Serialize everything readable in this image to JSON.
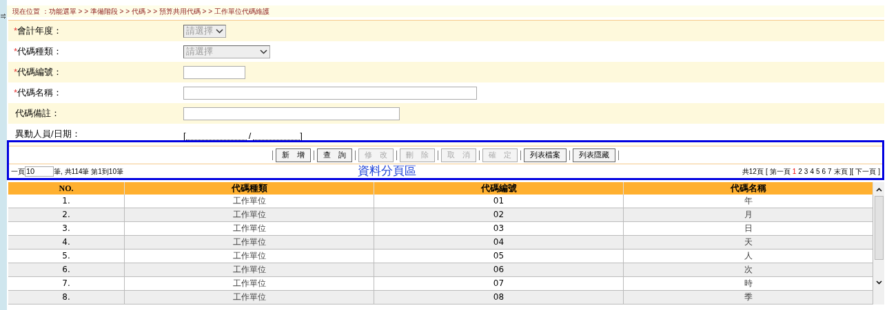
{
  "breadcrumb": "現在位置 ：功能選單 > > 準備階段 > > 代碼 > > 預算共用代碼 > > 工作單位代碼維護",
  "form": [
    {
      "mark": "*",
      "label": "會計年度：",
      "kind": "select",
      "value": "請選擇",
      "disabled": true
    },
    {
      "mark": "*",
      "label": "代碼種類：",
      "kind": "select",
      "value": "請選擇",
      "disabled": true
    },
    {
      "mark": "*",
      "label": "代碼編號：",
      "kind": "text"
    },
    {
      "mark": "*",
      "label": "代碼名稱：",
      "kind": "text"
    },
    {
      "label": "代碼備註：",
      "kind": "text"
    },
    {
      "label": "異動人員/日期：",
      "kind": "pair",
      "open": "[",
      "sep": "/",
      "close": "]"
    }
  ],
  "buttons": [
    {
      "label": "新　增",
      "disabled": false
    },
    {
      "label": "查　詢",
      "disabled": false
    },
    {
      "label": "修　改",
      "disabled": true
    },
    {
      "label": "刪　除",
      "disabled": true
    },
    {
      "label": "取　消",
      "disabled": true
    },
    {
      "label": "確　定",
      "disabled": true
    },
    {
      "label": "列表檔案",
      "disabled": false
    },
    {
      "label": "列表隱藏",
      "disabled": false
    }
  ],
  "pager": {
    "per_page_label": "一頁",
    "per_page": "10",
    "summary": "筆, 共114筆 第1到10筆",
    "area_label": "資料分頁區",
    "total_pages": "共12頁",
    "open": "[",
    "first": "第一頁",
    "pages": [
      {
        "label": "1",
        "selected": true
      },
      {
        "label": "2",
        "selected": false
      },
      {
        "label": "3",
        "selected": false
      },
      {
        "label": "4",
        "selected": false
      },
      {
        "label": "5",
        "selected": false
      },
      {
        "label": "6",
        "selected": false
      },
      {
        "label": "7",
        "selected": false
      }
    ],
    "last": "末頁",
    "mid": "][",
    "next": "下一頁",
    "close": "]"
  },
  "table": {
    "columns": [
      "NO.",
      "代碼種類",
      "代碼編號",
      "代碼名稱"
    ],
    "rows": [
      [
        "1.",
        "工作單位",
        "01",
        "年"
      ],
      [
        "2.",
        "工作單位",
        "02",
        "月"
      ],
      [
        "3.",
        "工作單位",
        "03",
        "日"
      ],
      [
        "4.",
        "工作單位",
        "04",
        "天"
      ],
      [
        "5.",
        "工作單位",
        "05",
        "人"
      ],
      [
        "6.",
        "工作單位",
        "06",
        "次"
      ],
      [
        "7.",
        "工作單位",
        "07",
        "時"
      ],
      [
        "8.",
        "工作單位",
        "08",
        "季"
      ]
    ]
  }
}
